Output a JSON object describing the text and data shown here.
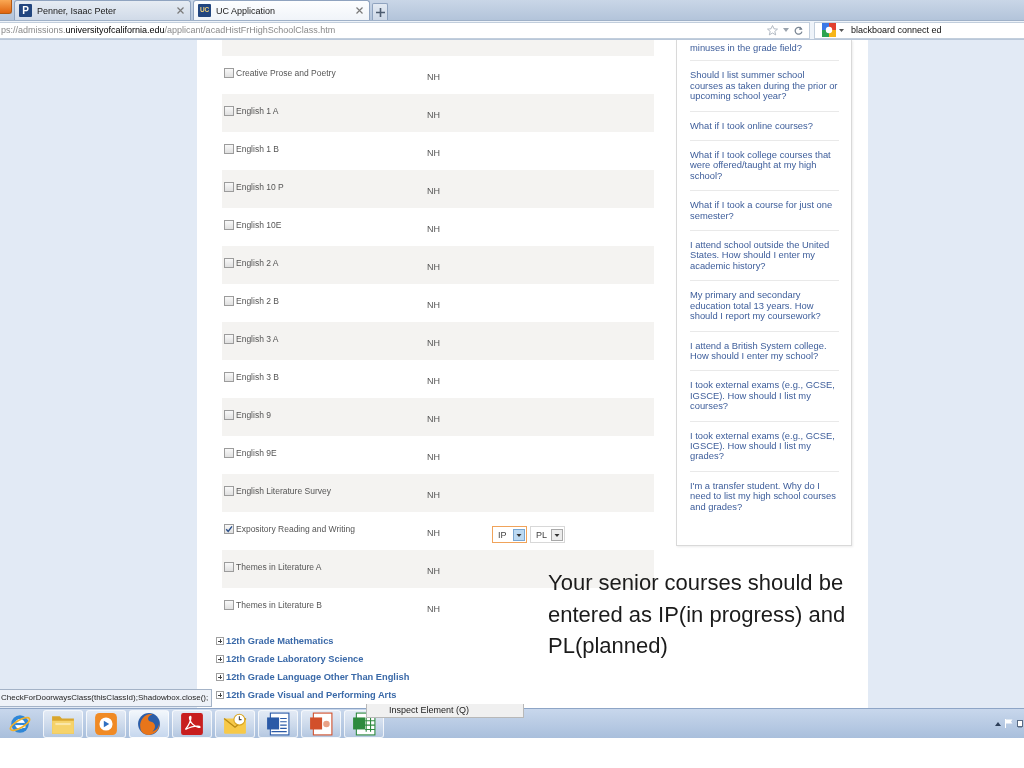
{
  "browser": {
    "tabs": [
      {
        "favicon": "P",
        "title": "Penner, Isaac Peter",
        "selected": false
      },
      {
        "favicon": "UC",
        "title": "UC Application",
        "selected": true
      }
    ],
    "address": "ps://admissions.**universityofcalifornia.edu**/applicant/acadHistFrHighSchoolClass.htm",
    "search": {
      "value": "blackboard connect ed"
    }
  },
  "courses": [
    {
      "name": "Creative Prose and Poetry",
      "checked": false,
      "grade": "NH"
    },
    {
      "name": "English 1 A",
      "checked": false,
      "grade": "NH"
    },
    {
      "name": "English 1 B",
      "checked": false,
      "grade": "NH"
    },
    {
      "name": "English 10 P",
      "checked": false,
      "grade": "NH"
    },
    {
      "name": "English 10E",
      "checked": false,
      "grade": "NH"
    },
    {
      "name": "English 2 A",
      "checked": false,
      "grade": "NH"
    },
    {
      "name": "English 2 B",
      "checked": false,
      "grade": "NH"
    },
    {
      "name": "English 3 A",
      "checked": false,
      "grade": "NH"
    },
    {
      "name": "English 3 B",
      "checked": false,
      "grade": "NH"
    },
    {
      "name": "English 9",
      "checked": false,
      "grade": "NH"
    },
    {
      "name": "English 9E",
      "checked": false,
      "grade": "NH"
    },
    {
      "name": "English Literature Survey",
      "checked": false,
      "grade": "NH"
    },
    {
      "name": "Expository Reading and Writing",
      "checked": true,
      "grade": "NH",
      "statuses": [
        {
          "value": "IP",
          "focused": true
        },
        {
          "value": "PL",
          "focused": false
        }
      ]
    },
    {
      "name": "Themes in Literature A",
      "checked": false,
      "grade": "NH"
    },
    {
      "name": "Themes in Literature B",
      "checked": false,
      "grade": "NH"
    }
  ],
  "sections": [
    {
      "label": "12th Grade Mathematics",
      "expanded": false
    },
    {
      "label": "12th Grade Laboratory Science",
      "expanded": false
    },
    {
      "label": "12th Grade Language Other Than English",
      "expanded": false
    },
    {
      "label": "12th Grade Visual and Performing Arts",
      "expanded": false
    }
  ],
  "faq": [
    "minuses in the grade field?",
    "Should I list summer school courses as taken during the prior or upcoming school year?",
    "What if I took online courses?",
    "What if I took college courses that were offered/taught at my high school?",
    "What if I took a course for just one semester?",
    "I attend school outside the United States. How should I enter my academic history?",
    "My primary and secondary education total 13 years. How should I report my coursework?",
    "I attend a British System college. How should I enter my school?",
    "I took external exams (e.g., GCSE, IGSCE). How should I list my courses?",
    "I took external exams (e.g., GCSE, IGSCE). How should I list my grades?",
    "I'm a transfer student. Why do I need to list my high school courses and grades?"
  ],
  "annotation": "Your senior courses should be entered as IP(in progress) and PL(planned)",
  "status_text": "CheckForDoorwaysClass(thisClassId);Shadowbox.close();",
  "context_menu": {
    "items": [
      "Inspect Element (Q)"
    ]
  },
  "taskbar": {
    "apps": [
      {
        "kind": "browser-e",
        "running": false,
        "active": false
      },
      {
        "kind": "folder",
        "running": true,
        "active": false
      },
      {
        "kind": "media",
        "running": true,
        "active": false
      },
      {
        "kind": "browser-fox",
        "running": true,
        "active": true
      },
      {
        "kind": "pdf",
        "running": true,
        "active": false
      },
      {
        "kind": "mail",
        "running": true,
        "active": false
      },
      {
        "kind": "document",
        "running": true,
        "active": false
      },
      {
        "kind": "slides",
        "running": true,
        "active": false
      },
      {
        "kind": "spreadsheet",
        "running": true,
        "active": false
      }
    ]
  }
}
